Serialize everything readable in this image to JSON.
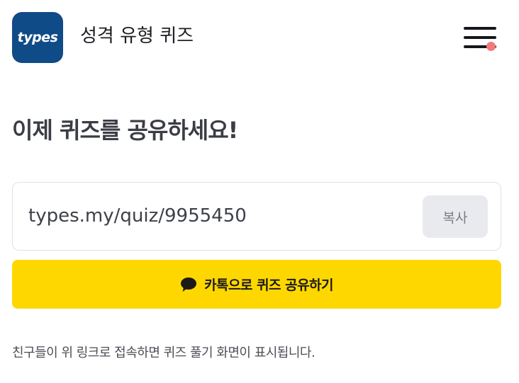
{
  "header": {
    "logo_text": "types",
    "title": "성격 유형 퀴즈",
    "menu_icon": "hamburger-icon",
    "notification_dot_color": "#f07b7b"
  },
  "main": {
    "heading": "이제 퀴즈를 공유하세요!",
    "share_link": "types.my/quiz/9955450",
    "copy_label": "복사",
    "kakao_share_label": "카톡으로 퀴즈 공유하기",
    "kakao_icon": "speech-bubble-icon",
    "note": "친구들이 위 링크로 접속하면 퀴즈 풀기 화면이 표시됩니다."
  },
  "colors": {
    "brand": "#0f4b86",
    "kakao": "#fed700"
  }
}
